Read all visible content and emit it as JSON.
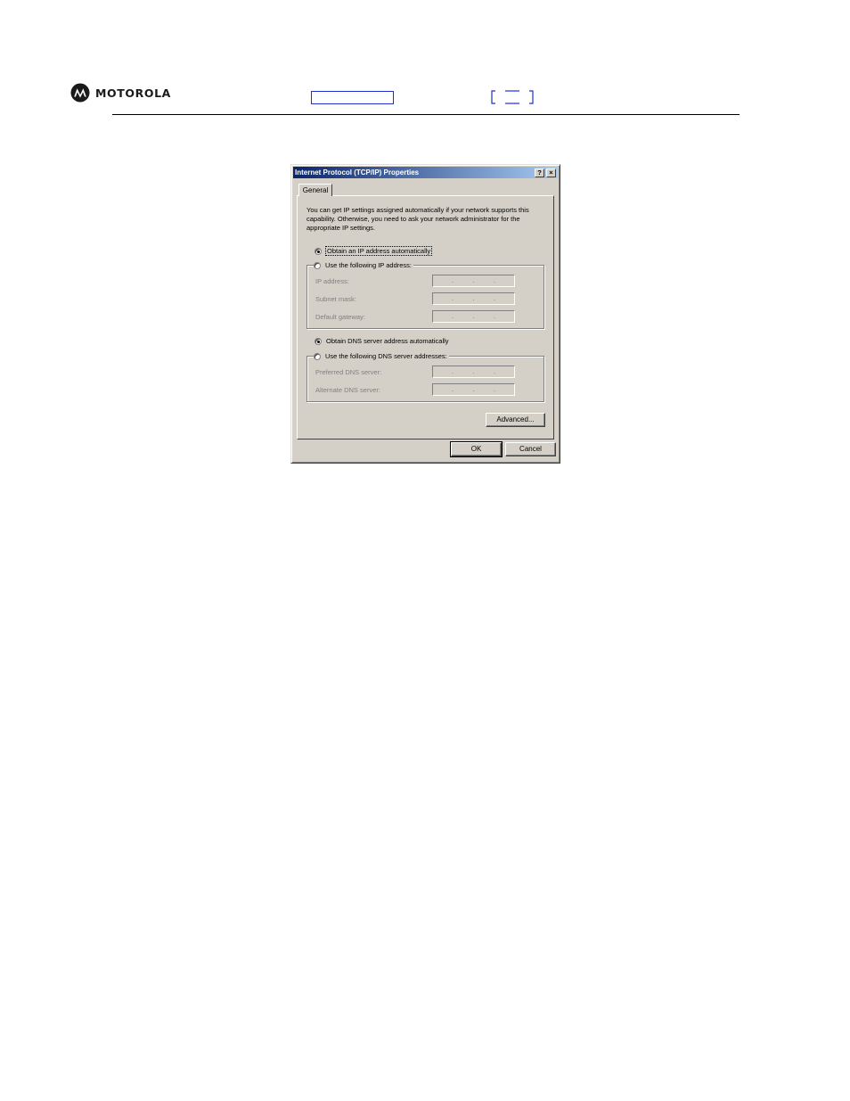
{
  "header": {
    "brand": "MOTOROLA"
  },
  "dialog": {
    "title": "Internet Protocol (TCP/IP) Properties",
    "help_glyph": "?",
    "close_glyph": "×",
    "tab_general": "General",
    "intro": "You can get IP settings assigned automatically if your network supports this capability. Otherwise, you need to ask your network administrator for the appropriate IP settings.",
    "ip_auto": "Obtain an IP address automatically",
    "ip_manual": "Use the following IP address:",
    "ip_address_label": "IP address:",
    "subnet_label": "Subnet mask:",
    "gateway_label": "Default gateway:",
    "dns_auto": "Obtain DNS server address automatically",
    "dns_manual": "Use the following DNS server addresses:",
    "preferred_dns_label": "Preferred DNS server:",
    "alternate_dns_label": "Alternate DNS server:",
    "ip_dot": ".",
    "advanced_button": "Advanced...",
    "ok_button": "OK",
    "cancel_button": "Cancel",
    "ip_mode": "automatic",
    "dns_mode": "automatic"
  },
  "colors": {
    "title_gradient_start": "#0a246a",
    "title_gradient_end": "#a6caf0",
    "window_face": "#d4d0c8",
    "link_blue": "#1f2fd1"
  },
  "icons": {
    "logo": "motorola-batwing-icon"
  }
}
